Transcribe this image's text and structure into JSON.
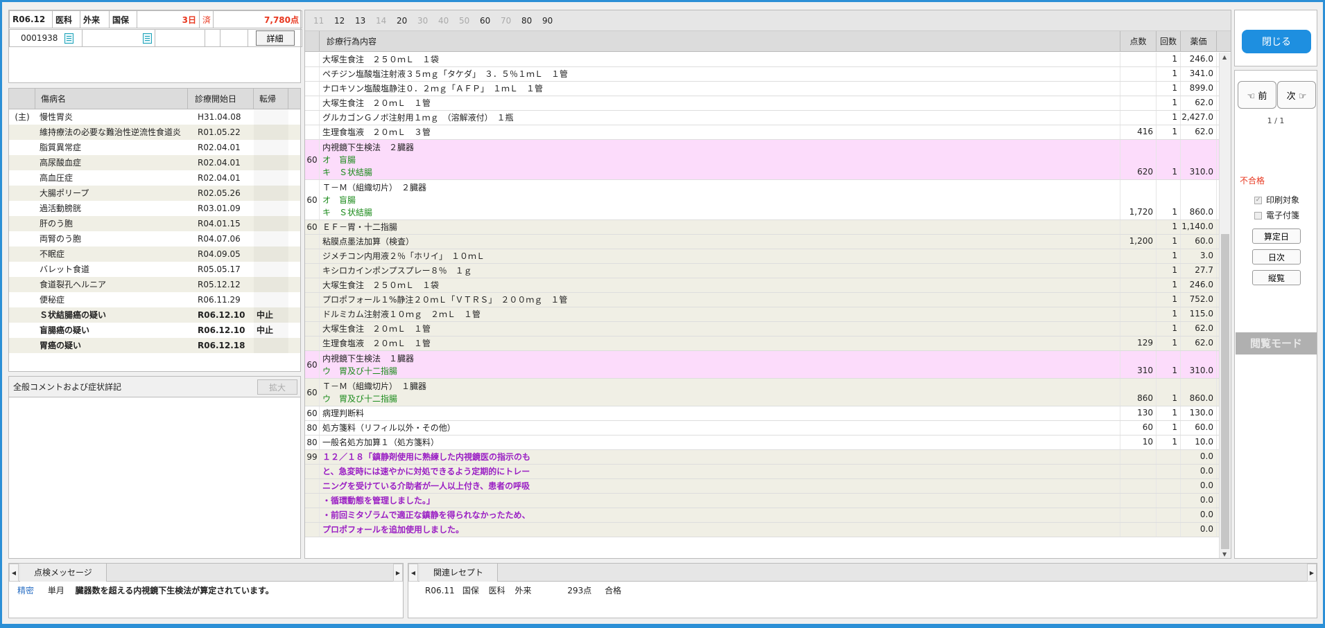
{
  "header": {
    "year_month": "R06.12",
    "type1": "医科",
    "type2": "外来",
    "insurance": "国保",
    "days": "3日",
    "status": "済",
    "points": "7,780点",
    "patient_id": "0001938",
    "detail_label": "詳細"
  },
  "disease": {
    "col_name": "傷病名",
    "col_date": "診療開始日",
    "col_outcome": "転帰",
    "rows": [
      {
        "main": "(主)",
        "name": "慢性胃炎",
        "date": "H31.04.08",
        "outcome": "",
        "bold": false
      },
      {
        "main": "",
        "name": "維持療法の必要な難治性逆流性食道炎",
        "date": "R01.05.22",
        "outcome": "",
        "bold": false
      },
      {
        "main": "",
        "name": "脂質異常症",
        "date": "R02.04.01",
        "outcome": "",
        "bold": false
      },
      {
        "main": "",
        "name": "高尿酸血症",
        "date": "R02.04.01",
        "outcome": "",
        "bold": false
      },
      {
        "main": "",
        "name": "高血圧症",
        "date": "R02.04.01",
        "outcome": "",
        "bold": false
      },
      {
        "main": "",
        "name": "大腸ポリープ",
        "date": "R02.05.26",
        "outcome": "",
        "bold": false
      },
      {
        "main": "",
        "name": "過活動膀胱",
        "date": "R03.01.09",
        "outcome": "",
        "bold": false
      },
      {
        "main": "",
        "name": "肝のう胞",
        "date": "R04.01.15",
        "outcome": "",
        "bold": false
      },
      {
        "main": "",
        "name": "両腎のう胞",
        "date": "R04.07.06",
        "outcome": "",
        "bold": false
      },
      {
        "main": "",
        "name": "不眠症",
        "date": "R04.09.05",
        "outcome": "",
        "bold": false
      },
      {
        "main": "",
        "name": "バレット食道",
        "date": "R05.05.17",
        "outcome": "",
        "bold": false
      },
      {
        "main": "",
        "name": "食道裂孔ヘルニア",
        "date": "R05.12.12",
        "outcome": "",
        "bold": false
      },
      {
        "main": "",
        "name": "便秘症",
        "date": "R06.11.29",
        "outcome": "",
        "bold": false
      },
      {
        "main": "",
        "name": "Ｓ状結腸癌の疑い",
        "date": "R06.12.10",
        "outcome": "中止",
        "bold": true
      },
      {
        "main": "",
        "name": "盲腸癌の疑い",
        "date": "R06.12.10",
        "outcome": "中止",
        "bold": true
      },
      {
        "main": "",
        "name": "胃癌の疑い",
        "date": "R06.12.18",
        "outcome": "",
        "bold": true
      }
    ]
  },
  "comment": {
    "title": "全般コメントおよび症状詳記",
    "expand_label": "拡大"
  },
  "pages": [
    {
      "label": "11",
      "active": false
    },
    {
      "label": "12",
      "active": true
    },
    {
      "label": "13",
      "active": true
    },
    {
      "label": "14",
      "active": false
    },
    {
      "label": "20",
      "active": true
    },
    {
      "label": "30",
      "active": false
    },
    {
      "label": "40",
      "active": false
    },
    {
      "label": "50",
      "active": false
    },
    {
      "label": "60",
      "active": true
    },
    {
      "label": "70",
      "active": false
    },
    {
      "label": "80",
      "active": true
    },
    {
      "label": "90",
      "active": true
    }
  ],
  "treatment": {
    "col_content": "診療行為内容",
    "col_points": "点数",
    "col_count": "回数",
    "col_price": "薬価",
    "rows": [
      {
        "cat": "",
        "bg": "w",
        "lines": [
          {
            "t": "大塚生食注　２５０ｍＬ　１袋",
            "c": ""
          }
        ],
        "pts": "",
        "cnt": "1",
        "price": "246.0"
      },
      {
        "cat": "",
        "bg": "w",
        "lines": [
          {
            "t": "ペチジン塩酸塩注射液３５ｍｇ「タケダ」　３．５％１ｍＬ　１管",
            "c": ""
          }
        ],
        "pts": "",
        "cnt": "1",
        "price": "341.0"
      },
      {
        "cat": "",
        "bg": "w",
        "lines": [
          {
            "t": "ナロキソン塩酸塩静注０．２ｍｇ「ＡＦＰ」　１ｍＬ　１管",
            "c": ""
          }
        ],
        "pts": "",
        "cnt": "1",
        "price": "899.0"
      },
      {
        "cat": "",
        "bg": "w",
        "lines": [
          {
            "t": "大塚生食注　２０ｍＬ　１管",
            "c": ""
          }
        ],
        "pts": "",
        "cnt": "1",
        "price": "62.0"
      },
      {
        "cat": "",
        "bg": "w",
        "lines": [
          {
            "t": "グルカゴンＧノボ注射用１ｍｇ　（溶解液付）　１瓶",
            "c": ""
          }
        ],
        "pts": "",
        "cnt": "1",
        "price": "2,427.0"
      },
      {
        "cat": "",
        "bg": "w",
        "lines": [
          {
            "t": "生理食塩液　２０ｍＬ　３管",
            "c": ""
          }
        ],
        "pts": "416",
        "cnt": "1",
        "price": "62.0"
      },
      {
        "cat": "60",
        "bg": "p",
        "lines": [
          {
            "t": "内視鏡下生検法　２臓器",
            "c": ""
          },
          {
            "t": "オ　盲腸",
            "c": "g"
          },
          {
            "t": "キ　Ｓ状結腸",
            "c": "g"
          }
        ],
        "pts": "620",
        "cnt": "1",
        "price": "310.0"
      },
      {
        "cat": "60",
        "bg": "w",
        "lines": [
          {
            "t": "Ｔ－Ｍ（組織切片）　２臓器",
            "c": ""
          },
          {
            "t": "オ　盲腸",
            "c": "g"
          },
          {
            "t": "キ　Ｓ状結腸",
            "c": "g"
          }
        ],
        "pts": "1,720",
        "cnt": "1",
        "price": "860.0"
      },
      {
        "cat": "60",
        "bg": "b",
        "lines": [
          {
            "t": "ＥＦ－胃・十二指腸",
            "c": ""
          }
        ],
        "pts": "",
        "cnt": "1",
        "price": "1,140.0"
      },
      {
        "cat": "",
        "bg": "b",
        "lines": [
          {
            "t": "粘膜点墨法加算（検査）",
            "c": ""
          }
        ],
        "pts": "1,200",
        "cnt": "1",
        "price": "60.0"
      },
      {
        "cat": "",
        "bg": "b",
        "lines": [
          {
            "t": "ジメチコン内用液２％「ホリイ」　１０ｍＬ",
            "c": ""
          }
        ],
        "pts": "",
        "cnt": "1",
        "price": "3.0"
      },
      {
        "cat": "",
        "bg": "b",
        "lines": [
          {
            "t": "キシロカインポンプスプレー８％　１ｇ",
            "c": ""
          }
        ],
        "pts": "",
        "cnt": "1",
        "price": "27.7"
      },
      {
        "cat": "",
        "bg": "b",
        "lines": [
          {
            "t": "大塚生食注　２５０ｍＬ　１袋",
            "c": ""
          }
        ],
        "pts": "",
        "cnt": "1",
        "price": "246.0"
      },
      {
        "cat": "",
        "bg": "b",
        "lines": [
          {
            "t": "プロポフォール１%静注２０ｍＬ「ＶＴＲＳ」　２００ｍｇ　１管",
            "c": ""
          }
        ],
        "pts": "",
        "cnt": "1",
        "price": "752.0"
      },
      {
        "cat": "",
        "bg": "b",
        "lines": [
          {
            "t": "ドルミカム注射液１０ｍｇ　２ｍＬ　１管",
            "c": ""
          }
        ],
        "pts": "",
        "cnt": "1",
        "price": "115.0"
      },
      {
        "cat": "",
        "bg": "b",
        "lines": [
          {
            "t": "大塚生食注　２０ｍＬ　１管",
            "c": ""
          }
        ],
        "pts": "",
        "cnt": "1",
        "price": "62.0"
      },
      {
        "cat": "",
        "bg": "b",
        "lines": [
          {
            "t": "生理食塩液　２０ｍＬ　１管",
            "c": ""
          }
        ],
        "pts": "129",
        "cnt": "1",
        "price": "62.0"
      },
      {
        "cat": "60",
        "bg": "p",
        "lines": [
          {
            "t": "内視鏡下生検法　１臓器",
            "c": ""
          },
          {
            "t": "ウ　胃及び十二指腸",
            "c": "g"
          }
        ],
        "pts": "310",
        "cnt": "1",
        "price": "310.0"
      },
      {
        "cat": "60",
        "bg": "b",
        "lines": [
          {
            "t": "Ｔ－Ｍ（組織切片）　１臓器",
            "c": ""
          },
          {
            "t": "ウ　胃及び十二指腸",
            "c": "g"
          }
        ],
        "pts": "860",
        "cnt": "1",
        "price": "860.0"
      },
      {
        "cat": "60",
        "bg": "w",
        "lines": [
          {
            "t": "病理判断料",
            "c": ""
          }
        ],
        "pts": "130",
        "cnt": "1",
        "price": "130.0"
      },
      {
        "cat": "80",
        "bg": "w",
        "lines": [
          {
            "t": "処方箋料（リフィル以外・その他）",
            "c": ""
          }
        ],
        "pts": "60",
        "cnt": "1",
        "price": "60.0"
      },
      {
        "cat": "80",
        "bg": "w",
        "lines": [
          {
            "t": "一般名処方加算１（処方箋料）",
            "c": ""
          }
        ],
        "pts": "10",
        "cnt": "1",
        "price": "10.0"
      },
      {
        "cat": "99",
        "bg": "b",
        "lines": [
          {
            "t": "１２／１８「鎮静剤使用に熟練した内視鏡医の指示のも",
            "c": "p"
          }
        ],
        "pts": "",
        "cnt": "",
        "price": "0.0"
      },
      {
        "cat": "",
        "bg": "b",
        "lines": [
          {
            "t": "と、急変時には速やかに対処できるよう定期的にトレー",
            "c": "p"
          }
        ],
        "pts": "",
        "cnt": "",
        "price": "0.0"
      },
      {
        "cat": "",
        "bg": "b",
        "lines": [
          {
            "t": "ニングを受けている介助者が一人以上付き、患者の呼吸",
            "c": "p"
          }
        ],
        "pts": "",
        "cnt": "",
        "price": "0.0"
      },
      {
        "cat": "",
        "bg": "b",
        "lines": [
          {
            "t": "・循環動態を管理しました。」",
            "c": "p"
          }
        ],
        "pts": "",
        "cnt": "",
        "price": "0.0"
      },
      {
        "cat": "",
        "bg": "b",
        "lines": [
          {
            "t": "・前回ミタゾラムで適正な鎮静を得られなかったため、",
            "c": "p"
          }
        ],
        "pts": "",
        "cnt": "",
        "price": "0.0"
      },
      {
        "cat": "",
        "bg": "b",
        "lines": [
          {
            "t": "プロポフォールを追加使用しました。",
            "c": "p"
          }
        ],
        "pts": "",
        "cnt": "",
        "price": "0.0"
      }
    ]
  },
  "right": {
    "close_label": "閉じる",
    "prev_label": "☜ 前",
    "next_label": "次 ☞",
    "page_indicator": "1 / 1",
    "fail_label": "不合格",
    "print_target": "印刷対象",
    "electronic_attach": "電子付箋",
    "calc_date": "算定日",
    "daily": "日次",
    "vertical": "縦覧",
    "browse_mode": "閲覧モード"
  },
  "check_msg": {
    "tab": "点検メッセージ",
    "level": "精密",
    "kind": "単月",
    "message": "臓器数を超える内視鏡下生検法が算定されています。"
  },
  "related": {
    "tab": "関連レセプト",
    "ym": "R06.11",
    "ins": "国保",
    "type1": "医科",
    "type2": "外来",
    "points": "293点",
    "result": "合格"
  },
  "colors": {
    "accent": "#1e8fe0",
    "pink_row": "#fcdcfb",
    "beige_row": "#f0efe5",
    "green_text": "#1a8a1a",
    "purple_text": "#9a1fc4",
    "red_text": "#e8371f"
  },
  "icons": [
    "document-icon",
    "check-icon",
    "chevron-up-icon",
    "chevron-down-icon",
    "chevron-left-icon",
    "chevron-right-icon",
    "hand-pointing-left-icon",
    "hand-pointing-right-icon"
  ]
}
